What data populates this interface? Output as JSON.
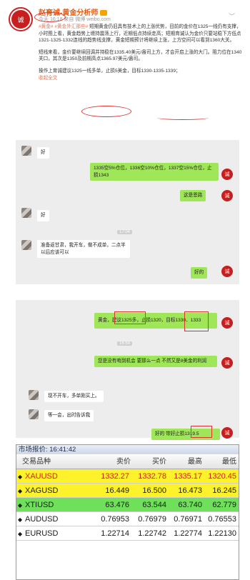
{
  "post": {
    "author": "赵育诚-黄金分析师",
    "time": "今天 16:18",
    "source": "来自 微博 weibo.com",
    "tags": "#黄金# #黄金外汇那些#",
    "p1": "短期黄金仍旧具有技术上的上涨优势，目前的金价在1325一线仍有支撑，小时图上看，黄金趋势上缠持震荡上行，近期低点持续走高；短期育诚认为金价只要站稳下方低点1321-1325-1332连线的趋势线支撑，黄金短期预计将继续上涨，上方空间可以看到1360大关。",
    "p2": "短线来看，金价要继续回调并持稳在1335.40美元/盎司上方，才会开启上涨的大门。阻力位在1340关口，其次是1350及前期高点1365.97美元/盎司。",
    "p3": "操作上育诚建议1325一线多单，止损5美金，目标1330-1335-1339；",
    "more": "收起全文"
  },
  "chat1": {
    "msg1": "好",
    "msg2": "1335空5%仓位，1336空10%仓位，1337空15%仓位，止损1343",
    "msg3": "这是恩路",
    "msg4": "好",
    "time": "17:04",
    "msg5": "准备返甘肃，我开车，做不成单，二点半以后应该可以",
    "msg6": "好的"
  },
  "chat2": {
    "msg1": "黄金，建议1325多，止损1320，目标1330、1333",
    "time": "16:59",
    "msg2": "您是没有哨到机会 要那么一点 不然又是8美金的利润",
    "msg3": "现不开车，多单刚买上。",
    "msg4": "等一会，出时告诉我",
    "msg5": "好的 带好止损1319.5"
  },
  "quote": {
    "title": "市场报价: 16:41:42",
    "headers": [
      "交易品种",
      "卖价",
      "买价",
      "最高",
      "最低"
    ],
    "rows": [
      {
        "sym": "XAUUSD",
        "sell": "1332.27",
        "buy": "1332.78",
        "high": "1335.17",
        "low": "1320.45"
      },
      {
        "sym": "XAGUSD",
        "sell": "16.449",
        "buy": "16.500",
        "high": "16.473",
        "low": "16.245"
      },
      {
        "sym": "XTIUSD",
        "sell": "63.476",
        "buy": "63.544",
        "high": "63.740",
        "low": "62.779"
      },
      {
        "sym": "AUDUSD",
        "sell": "0.76953",
        "buy": "0.76979",
        "high": "0.76971",
        "low": "0.76553"
      },
      {
        "sym": "EURUSD",
        "sell": "1.22714",
        "buy": "1.22742",
        "high": "1.22774",
        "low": "1.22130"
      }
    ],
    "colors": {
      "gold_row": "#fef22a",
      "green_row": "#6fe05a",
      "white_row": "#ffffff",
      "red_text": "#d81f1f"
    }
  }
}
